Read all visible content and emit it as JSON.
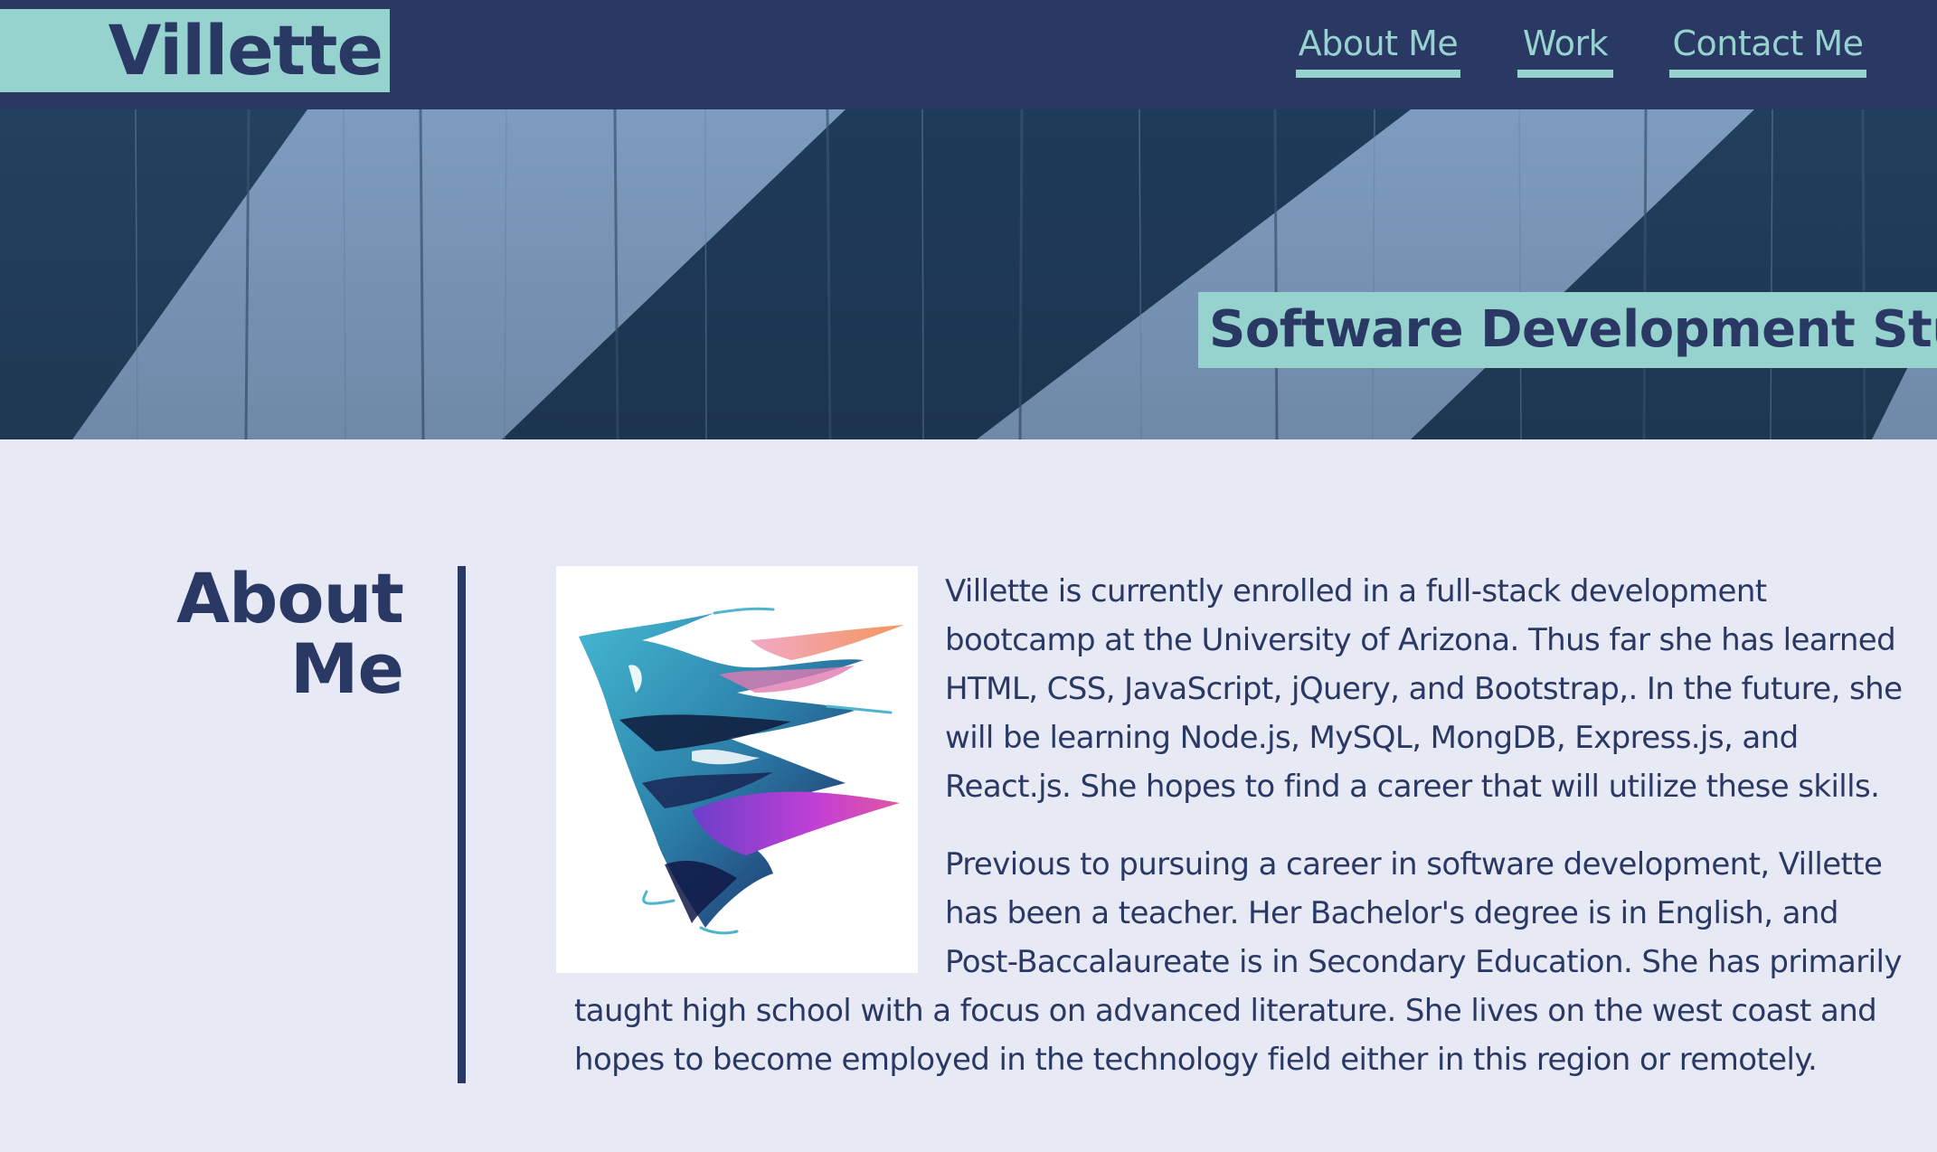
{
  "header": {
    "brand": "Villette",
    "nav": [
      {
        "label": "About Me"
      },
      {
        "label": "Work"
      },
      {
        "label": "Contact Me"
      }
    ]
  },
  "hero": {
    "tagline": "Software Development Stude"
  },
  "about": {
    "heading_line1": "About",
    "heading_line2": "Me",
    "paragraphs": [
      "Villette is currently enrolled in a full-stack development bootcamp at the University of Arizona. Thus far she has learned HTML, CSS, JavaScript, jQuery, and Bootstrap,. In the future, she will be learning Node.js, MySQL, MongDB, Express.js, and React.js. She hopes to find a career that will utilize these skills.",
      "Previous to pursuing a career in software development, Villette has been a teacher. Her Bachelor's degree is in English, and Post-Baccalaureate is in Secondary Education. She has primarily taught high school with a focus on advanced literature. She lives on the west coast and hopes to become employed in the technology field either in this region or remotely."
    ]
  },
  "colors": {
    "navy": "#2a3864",
    "teal": "#96d3cf",
    "page_bg": "#e7e9f5",
    "hero_light": "#7f9dc0",
    "hero_dark": "#1e3a5a"
  }
}
